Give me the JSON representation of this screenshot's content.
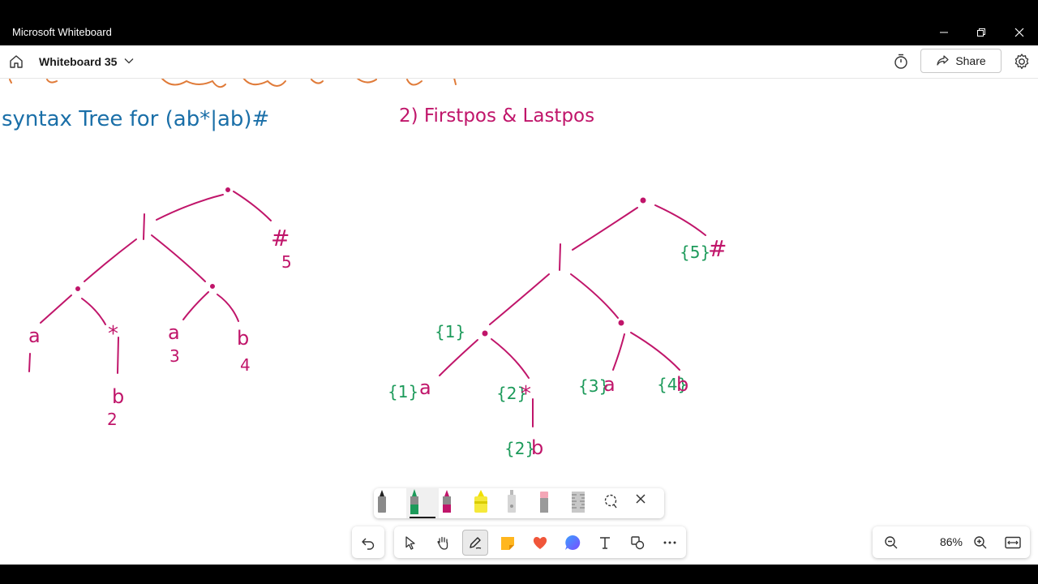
{
  "window": {
    "title": "Microsoft Whiteboard"
  },
  "header": {
    "board_name": "Whiteboard 35",
    "share_label": "Share"
  },
  "canvas": {
    "heading_left": "syntax Tree  for  (ab*|ab)#",
    "heading_right": "2) Firstpos  &  Lastpos",
    "tree1": {
      "hash": "#",
      "pos5": "5",
      "leaf_a1": "a",
      "pos1": "1",
      "star": "*",
      "leaf_b2": "b",
      "pos2": "2",
      "leaf_a3": "a",
      "pos3": "3",
      "leaf_b4": "b",
      "pos4": "4"
    },
    "tree2": {
      "fp_hash": "{5}",
      "hash": "#",
      "fp_cat": "{1}",
      "fp_a1": "{1}",
      "leaf_a1": "a",
      "fp_star": "{2}",
      "star": "*",
      "fp_b2": "{2}",
      "leaf_b2": "b",
      "fp_a3": "{3}",
      "leaf_a3": "a",
      "fp_b4": "{4}",
      "leaf_b4": "b"
    },
    "colors": {
      "blue": "#1a6fa8",
      "magenta": "#c0156a",
      "green": "#1c9a5a",
      "orange": "#e07b39"
    }
  },
  "toolbar": {
    "zoom": "86%"
  }
}
